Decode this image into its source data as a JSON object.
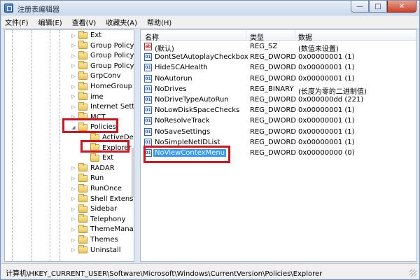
{
  "window": {
    "title": "注册表编辑器",
    "minimize": "—",
    "maximize": "□",
    "close": "✕"
  },
  "menu": [
    "文件(F)",
    "编辑(E)",
    "查看(V)",
    "收藏夹(A)",
    "帮助(H)"
  ],
  "tree": [
    {
      "label": "Ext",
      "level": 1
    },
    {
      "label": "Group Policy",
      "level": 1
    },
    {
      "label": "Group Policy E",
      "level": 1
    },
    {
      "label": "Group Policy C",
      "level": 1
    },
    {
      "label": "GrpConv",
      "level": 1
    },
    {
      "label": "HomeGroup",
      "level": 1
    },
    {
      "label": "ime",
      "level": 1
    },
    {
      "label": "Internet Setting",
      "level": 1
    },
    {
      "label": "MCT",
      "level": 1
    },
    {
      "label": "Policies",
      "level": 1,
      "expanded": true
    },
    {
      "label": "ActiveDeskt",
      "level": 2
    },
    {
      "label": "Explorer",
      "level": 2,
      "selected": true
    },
    {
      "label": "Ext",
      "level": 2
    },
    {
      "label": "RADAR",
      "level": 1
    },
    {
      "label": "Run",
      "level": 1
    },
    {
      "label": "RunOnce",
      "level": 1
    },
    {
      "label": "Shell Extension",
      "level": 1
    },
    {
      "label": "Sidebar",
      "level": 1
    },
    {
      "label": "Telephony",
      "level": 1
    },
    {
      "label": "ThemeManage",
      "level": 1
    },
    {
      "label": "Themes",
      "level": 1
    },
    {
      "label": "Uninstall",
      "level": 1
    }
  ],
  "columns": {
    "name": "名称",
    "type": "类型",
    "data": "数据"
  },
  "values": [
    {
      "name": "(默认)",
      "type": "REG_SZ",
      "data": "(数值未设置)",
      "icon": "string-value-icon"
    },
    {
      "name": "DontSetAutoplayCheckbox",
      "type": "REG_DWORD",
      "data": "0x00000001 (1)",
      "icon": "dword-value-icon"
    },
    {
      "name": "HideSCAHealth",
      "type": "REG_DWORD",
      "data": "0x00000001 (1)",
      "icon": "dword-value-icon"
    },
    {
      "name": "NoAutorun",
      "type": "REG_DWORD",
      "data": "0x00000001 (1)",
      "icon": "dword-value-icon"
    },
    {
      "name": "NoDrives",
      "type": "REG_BINARY",
      "data": "(长度为零的二进制值)",
      "icon": "dword-value-icon"
    },
    {
      "name": "NoDriveTypeAutoRun",
      "type": "REG_DWORD",
      "data": "0x000000dd (221)",
      "icon": "dword-value-icon"
    },
    {
      "name": "NoLowDiskSpaceChecks",
      "type": "REG_DWORD",
      "data": "0x00000001 (1)",
      "icon": "dword-value-icon"
    },
    {
      "name": "NoResolveTrack",
      "type": "REG_DWORD",
      "data": "0x00000001 (1)",
      "icon": "dword-value-icon"
    },
    {
      "name": "NoSaveSettings",
      "type": "REG_DWORD",
      "data": "0x00000001 (1)",
      "icon": "dword-value-icon"
    },
    {
      "name": "NoSimpleNetIDList",
      "type": "REG_DWORD",
      "data": "0x00000001 (1)",
      "icon": "dword-value-icon"
    },
    {
      "name": "NoViewContexMenu",
      "type": "REG_DWORD",
      "data": "0x00000000 (0)",
      "icon": "dword-value-icon",
      "selected": true
    }
  ],
  "status": "计算机\\HKEY_CURRENT_USER\\Software\\Microsoft\\Windows\\CurrentVersion\\Policies\\Explorer",
  "colors": {
    "highlight_box": "#d8131b",
    "selection": "#3399ff"
  }
}
